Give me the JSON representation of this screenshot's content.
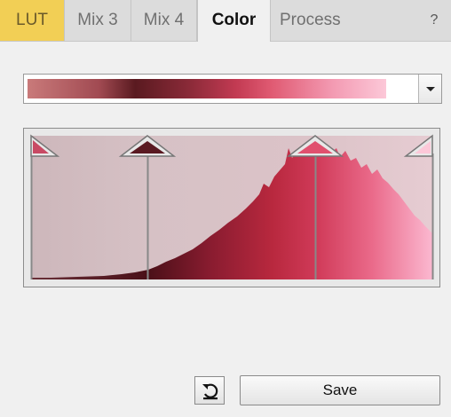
{
  "tabs": {
    "lut": "LUT",
    "mix3": "Mix 3",
    "mix4": "Mix 4",
    "color": "Color",
    "process": "Process",
    "help": "?"
  },
  "active_tab": "Color",
  "lut_selector": {
    "gradient_stops": [
      "#c97a7a",
      "#a14a52",
      "#5a1a20",
      "#8a2a38",
      "#c23a52",
      "#e05a72",
      "#f39ab2",
      "#fcc8d8"
    ],
    "dropdown_icon": "chevron-down-icon"
  },
  "histogram": {
    "colors": {
      "background_tint": "#d8c0c4",
      "fill_dark": "#4a1018",
      "fill_mid": "#b8283e",
      "fill_bright": "#e45a78",
      "fill_light": "#fbb8d0"
    },
    "handles": {
      "black_point": 0.0,
      "low": 0.29,
      "high": 0.71,
      "white_point": 1.0
    }
  },
  "buttons": {
    "reset_icon": "reset-icon",
    "save": "Save"
  }
}
